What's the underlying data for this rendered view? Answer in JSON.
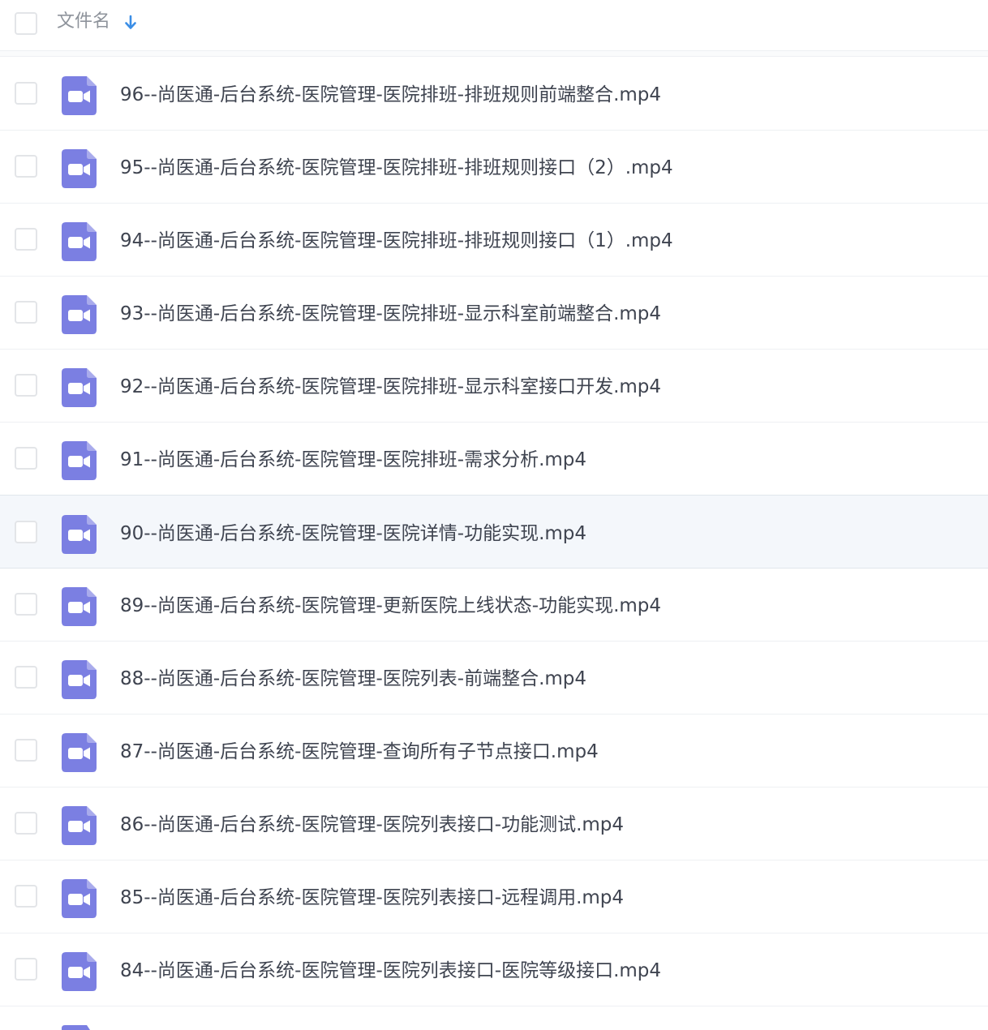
{
  "header": {
    "column_label": "文件名",
    "sort_icon": "arrow-down-icon",
    "sort_color": "#3a8ee6"
  },
  "file_icon": {
    "type": "video-file-icon",
    "color": "#7b7fe2"
  },
  "files": [
    {
      "name": "96--尚医通-后台系统-医院管理-医院排班-排班规则前端整合.mp4"
    },
    {
      "name": "95--尚医通-后台系统-医院管理-医院排班-排班规则接口（2）.mp4"
    },
    {
      "name": "94--尚医通-后台系统-医院管理-医院排班-排班规则接口（1）.mp4"
    },
    {
      "name": "93--尚医通-后台系统-医院管理-医院排班-显示科室前端整合.mp4"
    },
    {
      "name": "92--尚医通-后台系统-医院管理-医院排班-显示科室接口开发.mp4"
    },
    {
      "name": "91--尚医通-后台系统-医院管理-医院排班-需求分析.mp4"
    },
    {
      "name": "90--尚医通-后台系统-医院管理-医院详情-功能实现.mp4",
      "hovered": true
    },
    {
      "name": "89--尚医通-后台系统-医院管理-更新医院上线状态-功能实现.mp4"
    },
    {
      "name": "88--尚医通-后台系统-医院管理-医院列表-前端整合.mp4"
    },
    {
      "name": "87--尚医通-后台系统-医院管理-查询所有子节点接口.mp4"
    },
    {
      "name": "86--尚医通-后台系统-医院管理-医院列表接口-功能测试.mp4"
    },
    {
      "name": "85--尚医通-后台系统-医院管理-医院列表接口-远程调用.mp4"
    },
    {
      "name": "84--尚医通-后台系统-医院管理-医院列表接口-医院等级接口.mp4"
    }
  ]
}
